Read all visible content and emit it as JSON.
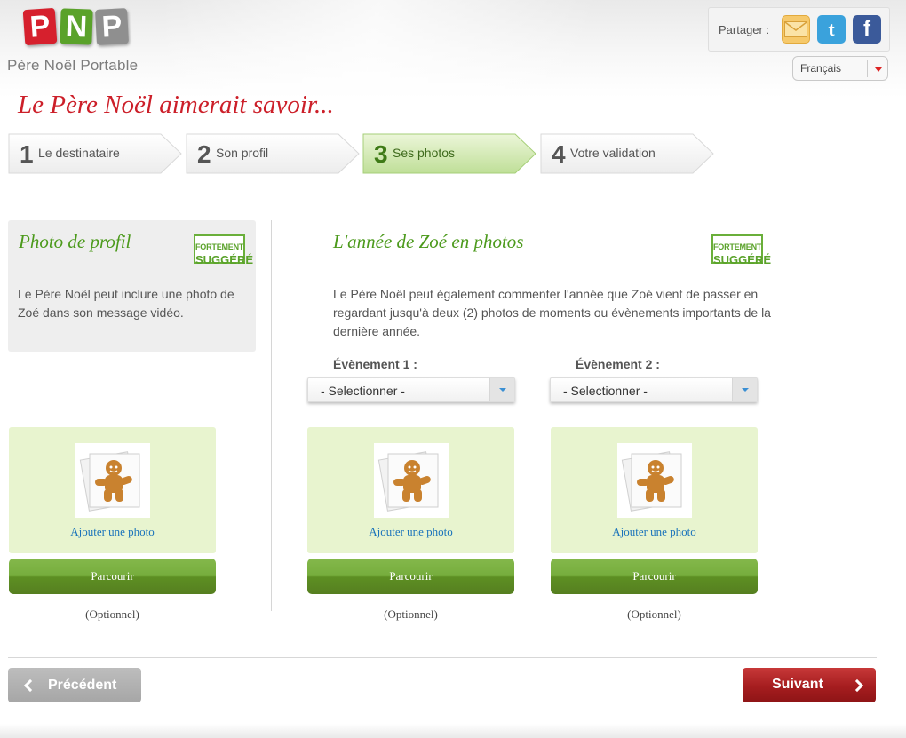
{
  "brand": {
    "logo_letters": [
      "P",
      "N",
      "P"
    ],
    "name": "Père Noël Portable"
  },
  "share": {
    "label": "Partager :",
    "icons": [
      "mail-icon",
      "twitter-icon",
      "facebook-icon"
    ],
    "twitter_glyph": "t",
    "facebook_glyph": "f"
  },
  "language": {
    "selected": "Français"
  },
  "title": "Le Père Noël aimerait savoir...",
  "steps": [
    {
      "num": "1",
      "label": "Le destinataire",
      "active": false
    },
    {
      "num": "2",
      "label": "Son profil",
      "active": false
    },
    {
      "num": "3",
      "label": "Ses photos",
      "active": true
    },
    {
      "num": "4",
      "label": "Votre validation",
      "active": false
    }
  ],
  "profile": {
    "title": "Photo de profil",
    "badge_top": "FORTEMENT",
    "badge_bottom": "SUGGÉRÉ",
    "description": "Le Père Noël peut inclure une photo de Zoé dans son message vidéo."
  },
  "events": {
    "title": "L'année de Zoé en photos",
    "badge_top": "FORTEMENT",
    "badge_bottom": "SUGGÉRÉ",
    "description": "Le Père Noël peut également commenter l'année que Zoé vient de passer en regardant jusqu'à deux (2) photos de moments ou évènements importants de la dernière année.",
    "event1_label": "Évènement 1 :",
    "event2_label": "Évènement 2 :",
    "event1_selected": "- Selectionner -",
    "event2_selected": "- Selectionner -"
  },
  "cards": [
    {
      "add_label": "Ajouter une photo",
      "browse_label": "Parcourir",
      "optional": "(Optionnel)"
    },
    {
      "add_label": "Ajouter une photo",
      "browse_label": "Parcourir",
      "optional": "(Optionnel)"
    },
    {
      "add_label": "Ajouter une photo",
      "browse_label": "Parcourir",
      "optional": "(Optionnel)"
    }
  ],
  "nav": {
    "previous": "Précédent",
    "next": "Suivant"
  },
  "colors": {
    "brand_red": "#cc1f29",
    "brand_green": "#5aa22a",
    "card_bg": "#e8f4cf"
  }
}
